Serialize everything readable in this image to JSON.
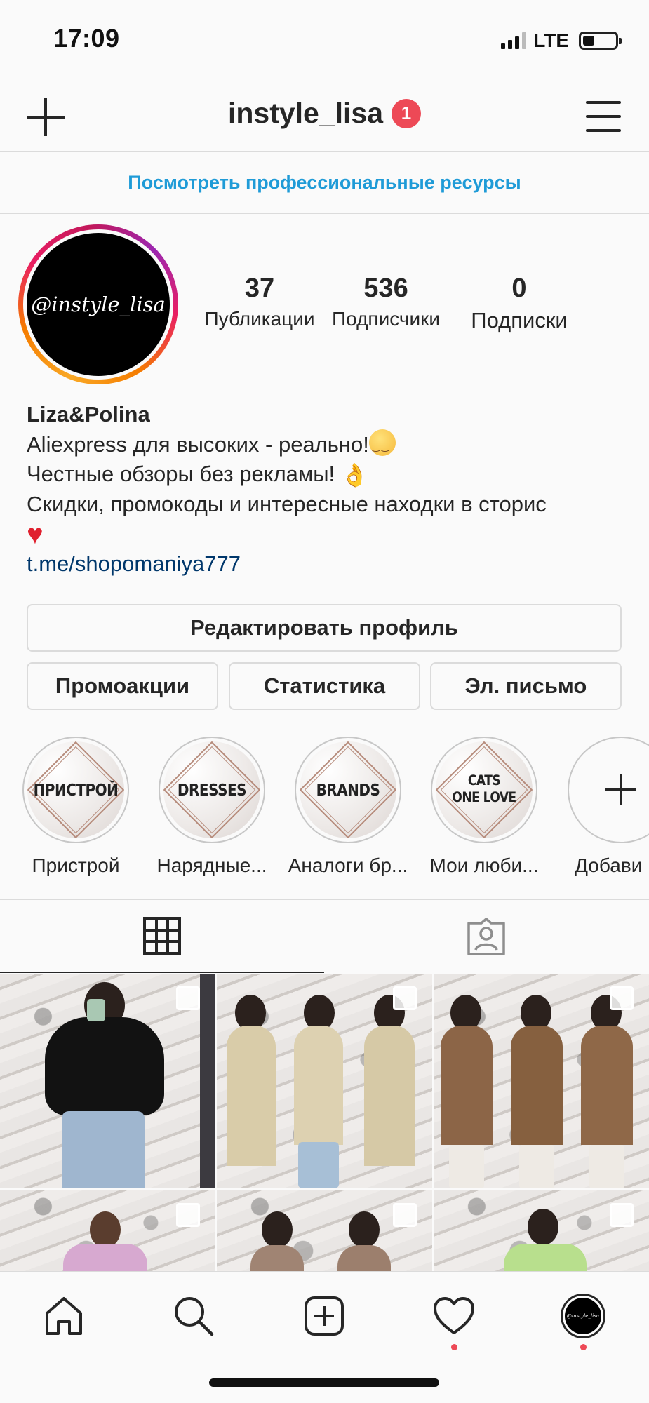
{
  "status_bar": {
    "time": "17:09",
    "network": "LTE"
  },
  "header": {
    "username": "instyle_lisa",
    "notification_count": "1"
  },
  "pro_resources_link": "Посмотреть профессиональные ресурсы",
  "avatar": {
    "text": "@instyle_lisa"
  },
  "stats": [
    {
      "value": "37",
      "label": "Публикации"
    },
    {
      "value": "536",
      "label": "Подписчики"
    },
    {
      "value": "0",
      "label": "Подписки"
    }
  ],
  "bio": {
    "name": "Liza&Polina",
    "line1": "Aliexpress для высоких - реально!",
    "line2": "Честные обзоры без рекламы!",
    "line3": "Скидки, промокоды и интересные находки в сторис",
    "link": "t.me/shopomaniya777"
  },
  "buttons": {
    "edit_profile": "Редактировать профиль",
    "promotions": "Промоакции",
    "statistics": "Статистика",
    "email": "Эл. письмо"
  },
  "highlights": [
    {
      "cover_text": "ПРИСТРОЙ",
      "label": "Пристрой"
    },
    {
      "cover_text": "DRESSES",
      "label": "Нарядные..."
    },
    {
      "cover_text": "BRANDS",
      "label": "Аналоги бр..."
    },
    {
      "cover_text": "CATS\nONE LOVE",
      "label": "Мои люби..."
    },
    {
      "cover_text": "",
      "label": "Добави"
    }
  ],
  "tabs": [
    {
      "icon": "grid-icon",
      "active": true
    },
    {
      "icon": "tagged-person-icon",
      "active": false
    }
  ],
  "bottom_nav": [
    {
      "icon": "home-icon"
    },
    {
      "icon": "search-icon"
    },
    {
      "icon": "new-post-icon"
    },
    {
      "icon": "heart-icon",
      "has_dot": true
    },
    {
      "icon": "profile-avatar-icon",
      "has_dot": true
    }
  ],
  "colors": {
    "link_blue": "#1f9bd7",
    "bio_link": "#00376b",
    "badge_red": "#ed4956",
    "text": "#262626",
    "border": "#dbdbdb"
  }
}
